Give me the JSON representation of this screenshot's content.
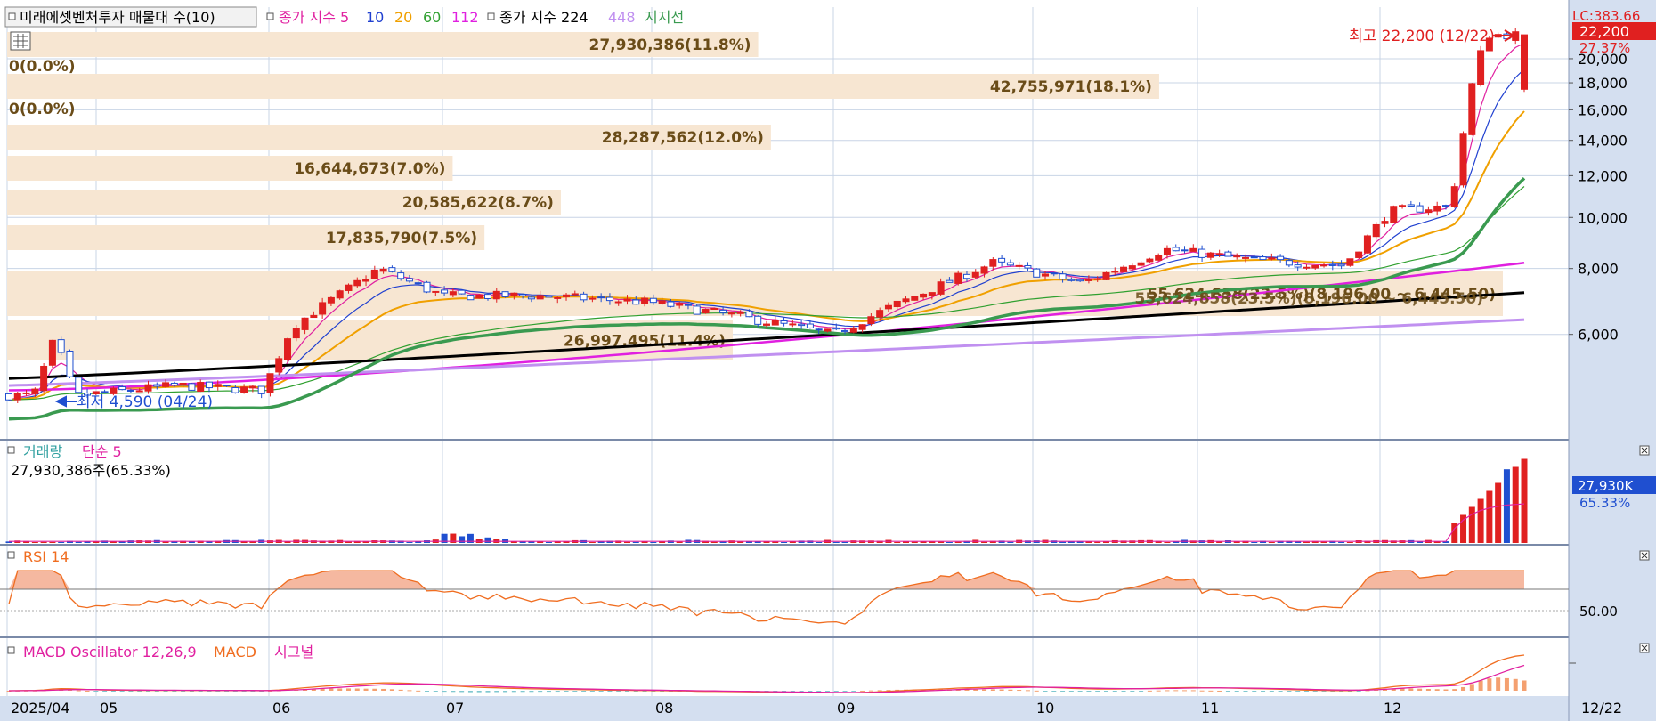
{
  "colors": {
    "rise": "#e02020",
    "fall": "#1f4fd0",
    "ma5": "#e020a0",
    "ma10": "#2040d0",
    "ma20": "#f0a000",
    "ma60": "#30a030",
    "ma112": "#e020e0",
    "ma224": "#000000",
    "ma448": "#c090f0",
    "support": "#3a9a50",
    "profile": "#f7e6d2",
    "profileText": "#6a4c18",
    "volume": "#e020a0",
    "rsi": "#f06d20",
    "rsiFill": "#f5b8a0",
    "macd": "#f06d20",
    "signal": "#e020a0",
    "axisBg": "#d4dff0",
    "grid": "#c8d4e6"
  },
  "header": {
    "title": "미래에셋벤처투자 매물대 수(10)",
    "legend": [
      {
        "text": "종가 지수 5",
        "color": "#e020a0"
      },
      {
        "text": "10",
        "color": "#2040d0"
      },
      {
        "text": "20",
        "color": "#f0a000"
      },
      {
        "text": "60",
        "color": "#30a030"
      },
      {
        "text": "112",
        "color": "#e020e0"
      },
      {
        "text": "종가 지수 224",
        "color": "#000000"
      },
      {
        "text": "448",
        "color": "#c090f0"
      },
      {
        "text": "지지선",
        "color": "#3a9a50"
      }
    ]
  },
  "price_axis": {
    "corner": "LC:383.66",
    "ticks": [
      "22,200",
      "20,000",
      "18,000",
      "16,000",
      "14,000",
      "12,000",
      "10,000",
      "8,000",
      "6,000"
    ],
    "current": "22,200",
    "change": "27.37%"
  },
  "annotations": {
    "high": "최고 22,200 (12/22)",
    "low": "최저 4,590 (04/24)",
    "range": "55,624,858(23.5%)(8,196.00 ~ 6,445.50)"
  },
  "volume_panel": {
    "title": "거래량",
    "ma": "단순 5",
    "value": "27,930,386주(65.33%)",
    "axis_value": "27,930K",
    "axis_pct": "65.33%"
  },
  "rsi_panel": {
    "title": "RSI 14",
    "axis": "50.00"
  },
  "macd_panel": {
    "osc": "MACD Oscillator 12,26,9",
    "macd": "MACD",
    "signal": "시그널"
  },
  "x_axis": [
    "2025/04",
    "05",
    "06",
    "07",
    "08",
    "09",
    "10",
    "11",
    "12",
    "12/22"
  ],
  "chart_data": {
    "type": "candlestick",
    "title": "미래에셋벤처투자 매물대 수(10)",
    "period": "2025/04 - 12/22",
    "price_range": [
      4000,
      23000
    ],
    "log_scale": true,
    "high": {
      "value": 22200,
      "date": "12/22"
    },
    "low": {
      "value": 4590,
      "date": "04/24"
    },
    "close_path": [
      {
        "date": "04/10",
        "close": 4600
      },
      {
        "date": "04/17",
        "close": 5900
      },
      {
        "date": "04/24",
        "close": 4590
      },
      {
        "date": "05/15",
        "close": 4800
      },
      {
        "date": "05/30",
        "close": 4700
      },
      {
        "date": "06/05",
        "close": 6200
      },
      {
        "date": "06/12",
        "close": 7000
      },
      {
        "date": "06/20",
        "close": 8000
      },
      {
        "date": "07/01",
        "close": 7100
      },
      {
        "date": "07/15",
        "close": 7100
      },
      {
        "date": "08/01",
        "close": 6900
      },
      {
        "date": "08/15",
        "close": 6500
      },
      {
        "date": "09/01",
        "close": 6000
      },
      {
        "date": "09/10",
        "close": 6800
      },
      {
        "date": "09/25",
        "close": 8200
      },
      {
        "date": "10/10",
        "close": 7500
      },
      {
        "date": "10/25",
        "close": 8700
      },
      {
        "date": "11/10",
        "close": 8300
      },
      {
        "date": "11/25",
        "close": 8100
      },
      {
        "date": "12/03",
        "close": 10300
      },
      {
        "date": "12/15",
        "close": 10500
      },
      {
        "date": "12/19",
        "close": 17500
      },
      {
        "date": "12/22",
        "close": 22200
      }
    ],
    "volume_profile": [
      {
        "label": "27,930,386(11.8%)",
        "pct": 11.8
      },
      {
        "label": "0(0.0%)",
        "pct": 0
      },
      {
        "label": "42,755,971(18.1%)",
        "pct": 18.1
      },
      {
        "label": "0(0.0%)",
        "pct": 0
      },
      {
        "label": "28,287,562(12.0%)",
        "pct": 12.0
      },
      {
        "label": "16,644,673(7.0%)",
        "pct": 7.0
      },
      {
        "label": "20,585,622(8.7%)",
        "pct": 8.7
      },
      {
        "label": "17,835,790(7.5%)",
        "pct": 7.5
      },
      {
        "label": "55,624,858(23.5%)(8,196.00 ~ 6,445.50)",
        "pct": 23.5
      },
      {
        "label": "26,997,495(11.4%)",
        "pct": 11.4
      }
    ],
    "moving_averages": [
      "5",
      "10",
      "20",
      "60",
      "112",
      "224",
      "448"
    ]
  }
}
